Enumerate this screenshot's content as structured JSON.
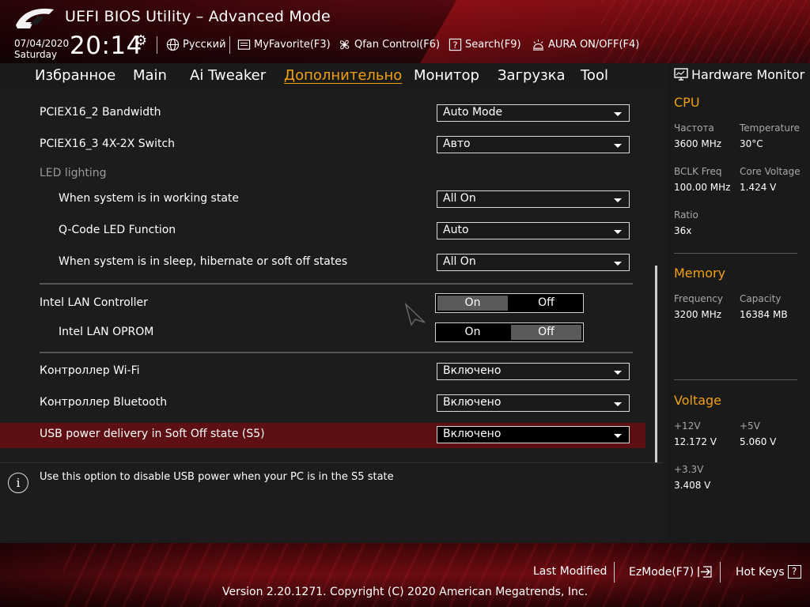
{
  "header": {
    "title": "UEFI BIOS Utility – Advanced Mode",
    "date": "07/04/2020",
    "weekday": "Saturday",
    "time": "20:14",
    "items": {
      "language": "Русский",
      "myfavorite": "MyFavorite(F3)",
      "qfan": "Qfan Control(F6)",
      "search": "Search(F9)",
      "aura": "AURA ON/OFF(F4)"
    }
  },
  "tabs": [
    {
      "label": "Избранное"
    },
    {
      "label": "Main"
    },
    {
      "label": "Ai Tweaker"
    },
    {
      "label": "Дополнительно",
      "active": true
    },
    {
      "label": "Монитор"
    },
    {
      "label": "Загрузка"
    },
    {
      "label": "Tool"
    }
  ],
  "settings": {
    "pciex16_2": {
      "label": "PCIEX16_2 Bandwidth",
      "value": "Auto Mode"
    },
    "pciex16_3": {
      "label": "PCIEX16_3 4X-2X Switch",
      "value": "Авто"
    },
    "led_section": "LED lighting",
    "working_state": {
      "label": "When system is in working state",
      "value": "All On"
    },
    "qcode_led": {
      "label": "Q-Code LED Function",
      "value": "Auto"
    },
    "sleep_state": {
      "label": "When system is in sleep, hibernate or soft off states",
      "value": "All On"
    },
    "intel_lan": {
      "label": "Intel LAN Controller",
      "on": "On",
      "off": "Off",
      "selected": "On"
    },
    "intel_oprom": {
      "label": "Intel LAN OPROM",
      "on": "On",
      "off": "Off",
      "selected": "Off"
    },
    "wifi": {
      "label": "Контроллер Wi-Fi",
      "value": "Включено"
    },
    "bluetooth": {
      "label": "Контроллер Bluetooth",
      "value": "Включено"
    },
    "usb_power": {
      "label": "USB power delivery in Soft Off state (S5)",
      "value": "Включено"
    }
  },
  "help": {
    "text": "Use this option to disable USB power when your PC is in the S5 state"
  },
  "hwmon": {
    "title": "Hardware Monitor",
    "cpu": {
      "title": "CPU",
      "freq_label": "Частота",
      "freq": "3600 MHz",
      "temp_label": "Temperature",
      "temp": "30°C",
      "bclk_label": "BCLK Freq",
      "bclk": "100.00 MHz",
      "vcore_label": "Core Voltage",
      "vcore": "1.424 V",
      "ratio_label": "Ratio",
      "ratio": "36x"
    },
    "memory": {
      "title": "Memory",
      "freq_label": "Frequency",
      "freq": "3200 MHz",
      "cap_label": "Capacity",
      "cap": "16384 MB"
    },
    "voltage": {
      "title": "Voltage",
      "v12_label": "+12V",
      "v12": "12.172 V",
      "v5_label": "+5V",
      "v5": "5.060 V",
      "v33_label": "+3.3V",
      "v33": "3.408 V"
    }
  },
  "footer": {
    "last_modified": "Last Modified",
    "ezmode": "EzMode(F7)",
    "hotkeys": "Hot Keys",
    "hotkeys_icon": "?",
    "copyright": "Version 2.20.1271. Copyright (C) 2020 American Megatrends, Inc."
  },
  "icons": {
    "info": "i",
    "gear": "⚙"
  },
  "colors": {
    "accent": "#f0a010",
    "highlight": "#5e0f13",
    "brand_red": "#6b0c12"
  }
}
